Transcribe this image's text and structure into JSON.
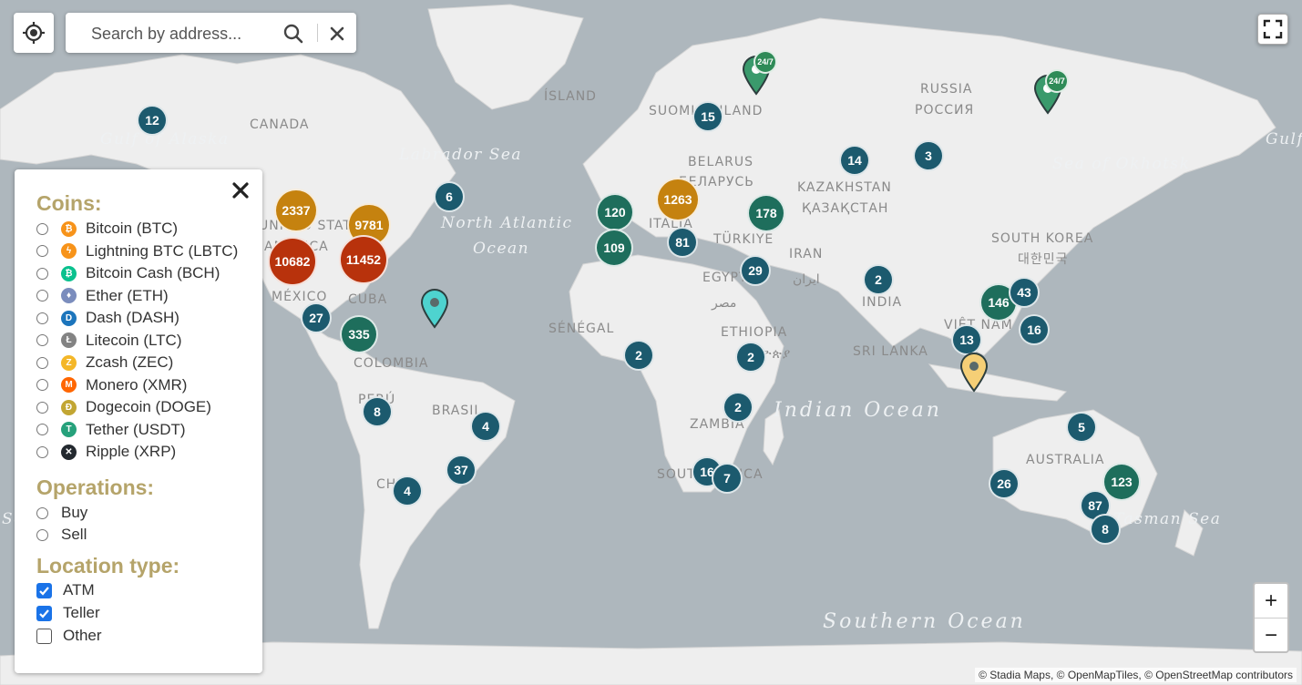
{
  "search": {
    "placeholder": "Search by address..."
  },
  "labels": {
    "countries": [
      {
        "text": "CANADA"
      },
      {
        "text": "ÍSLAND"
      },
      {
        "text": "SUOMI FINLAND"
      },
      {
        "text": "BELARUS"
      },
      {
        "text": "БЕЛАРУСЬ"
      },
      {
        "text": "RUSSIA"
      },
      {
        "text": "РОССИЯ"
      },
      {
        "text": "KAZAKHSTAN"
      },
      {
        "text": "ҚАЗАҚСТАН"
      },
      {
        "text": "ITALIA"
      },
      {
        "text": "TÜRKIYE"
      },
      {
        "text": "IRAN"
      },
      {
        "text": "ایران"
      },
      {
        "text": "EGYPT"
      },
      {
        "text": "مصر"
      },
      {
        "text": "SÉNÉGAL"
      },
      {
        "text": "ETHIOPIA"
      },
      {
        "text": "ኢትዮጵያ"
      },
      {
        "text": "INDIA"
      },
      {
        "text": "SRI LANKA"
      },
      {
        "text": "SOUTH KOREA"
      },
      {
        "text": "대한민국"
      },
      {
        "text": "VIỆT NAM"
      },
      {
        "text": "MÉXICO"
      },
      {
        "text": "CUBA"
      },
      {
        "text": "COLOMBIA"
      },
      {
        "text": "PERÚ"
      },
      {
        "text": "BRASIL"
      },
      {
        "text": "ZAMBIA"
      },
      {
        "text": "SOUTH AFRICA"
      },
      {
        "text": "AUSTRALIA"
      },
      {
        "text": "UNITED STATES"
      },
      {
        "text": "AMERICA"
      },
      {
        "text": "CHILE"
      }
    ],
    "seas": [
      {
        "text": "Gulf of Alaska"
      },
      {
        "text": "Labrador Sea"
      },
      {
        "text": "North Atlantic"
      },
      {
        "text": "Ocean"
      },
      {
        "text": "Sea of Okhotsk"
      },
      {
        "text": "Gulf"
      },
      {
        "text": "Indian Ocean"
      },
      {
        "text": "Southern Ocean"
      },
      {
        "text": "Tasman Sea"
      },
      {
        "text": "Se"
      }
    ]
  },
  "clusters": [
    {
      "count": "12",
      "color": "#1c5a6e"
    },
    {
      "count": "6",
      "color": "#1c5a6e"
    },
    {
      "count": "2337",
      "color": "#c5820f"
    },
    {
      "count": "9781",
      "color": "#c5820f"
    },
    {
      "count": "10682",
      "color": "#b8320c"
    },
    {
      "count": "11452",
      "color": "#b8320c"
    },
    {
      "count": "27",
      "color": "#1c5a6e"
    },
    {
      "count": "335",
      "color": "#1e6e5c"
    },
    {
      "count": "8",
      "color": "#1c5a6e"
    },
    {
      "count": "4",
      "color": "#1c5a6e"
    },
    {
      "count": "37",
      "color": "#1c5a6e"
    },
    {
      "count": "4",
      "color": "#1c5a6e"
    },
    {
      "count": "15",
      "color": "#1c5a6e"
    },
    {
      "count": "120",
      "color": "#1e6e5c"
    },
    {
      "count": "109",
      "color": "#1e6e5c"
    },
    {
      "count": "1263",
      "color": "#c5820f"
    },
    {
      "count": "81",
      "color": "#1c5a6e"
    },
    {
      "count": "178",
      "color": "#1e6e5c"
    },
    {
      "count": "29",
      "color": "#1c5a6e"
    },
    {
      "count": "14",
      "color": "#1c5a6e"
    },
    {
      "count": "3",
      "color": "#1c5a6e"
    },
    {
      "count": "2",
      "color": "#1c5a6e"
    },
    {
      "count": "2",
      "color": "#1c5a6e"
    },
    {
      "count": "2",
      "color": "#1c5a6e"
    },
    {
      "count": "2",
      "color": "#1c5a6e"
    },
    {
      "count": "16",
      "color": "#1c5a6e"
    },
    {
      "count": "7",
      "color": "#1c5a6e"
    },
    {
      "count": "146",
      "color": "#1e6e5c"
    },
    {
      "count": "43",
      "color": "#1c5a6e"
    },
    {
      "count": "16",
      "color": "#1c5a6e"
    },
    {
      "count": "13",
      "color": "#1c5a6e"
    },
    {
      "count": "5",
      "color": "#1c5a6e"
    },
    {
      "count": "26",
      "color": "#1c5a6e"
    },
    {
      "count": "123",
      "color": "#1e6e5c"
    },
    {
      "count": "87",
      "color": "#1c5a6e"
    },
    {
      "count": "8",
      "color": "#1c5a6e"
    }
  ],
  "pins": [
    {
      "badge": "24/7",
      "color": "#3a9a6c"
    },
    {
      "badge": "24/7",
      "color": "#3a9a6c"
    },
    {
      "badge": "",
      "color": "#4ed3cf"
    },
    {
      "badge": "",
      "color": "#f5cf76"
    }
  ],
  "panel": {
    "coins_heading": "Coins:",
    "coins": [
      {
        "label": "Bitcoin (BTC)",
        "icon": "bitcoin-icon",
        "color": "#f7931a",
        "glyph": "₿"
      },
      {
        "label": "Lightning BTC (LBTC)",
        "icon": "lightning-icon",
        "color": "#f7931a",
        "glyph": "ϟ"
      },
      {
        "label": "Bitcoin Cash (BCH)",
        "icon": "bitcoin-cash-icon",
        "color": "#0ac18e",
        "glyph": "₿"
      },
      {
        "label": "Ether (ETH)",
        "icon": "ether-icon",
        "color": "#7b8dbd",
        "glyph": "♦"
      },
      {
        "label": "Dash (DASH)",
        "icon": "dash-icon",
        "color": "#1c75bc",
        "glyph": "D"
      },
      {
        "label": "Litecoin (LTC)",
        "icon": "litecoin-icon",
        "color": "#838383",
        "glyph": "Ł"
      },
      {
        "label": "Zcash (ZEC)",
        "icon": "zcash-icon",
        "color": "#f4b728",
        "glyph": "Z"
      },
      {
        "label": "Monero (XMR)",
        "icon": "monero-icon",
        "color": "#ff6600",
        "glyph": "M"
      },
      {
        "label": "Dogecoin (DOGE)",
        "icon": "dogecoin-icon",
        "color": "#c2a633",
        "glyph": "Đ"
      },
      {
        "label": "Tether (USDT)",
        "icon": "tether-icon",
        "color": "#26a17b",
        "glyph": "T"
      },
      {
        "label": "Ripple (XRP)",
        "icon": "ripple-icon",
        "color": "#23292f",
        "glyph": "✕"
      }
    ],
    "operations_heading": "Operations:",
    "operations": [
      {
        "label": "Buy"
      },
      {
        "label": "Sell"
      }
    ],
    "location_heading": "Location type:",
    "locations": [
      {
        "label": "ATM",
        "checked": true
      },
      {
        "label": "Teller",
        "checked": true
      },
      {
        "label": "Other",
        "checked": false
      }
    ]
  },
  "controls": {
    "zoom_in": "+",
    "zoom_out": "−"
  },
  "attribution": "© Stadia Maps, © OpenMapTiles, © OpenStreetMap contributors"
}
